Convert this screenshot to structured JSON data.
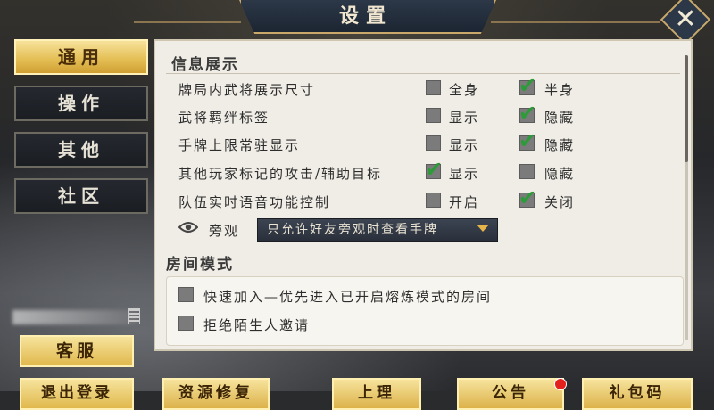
{
  "window": {
    "title": "设置",
    "close_icon": "close-icon"
  },
  "sidebar": {
    "tabs": [
      {
        "label": "通用",
        "active": true
      },
      {
        "label": "操作",
        "active": false
      },
      {
        "label": "其他",
        "active": false
      },
      {
        "label": "社区",
        "active": false
      }
    ],
    "customer_service": "客服",
    "logout": "退出登录"
  },
  "info_section": {
    "title": "信息展示",
    "rows": [
      {
        "label": "牌局内武将展示尺寸",
        "opt1": "全身",
        "opt1_checked": false,
        "opt2": "半身",
        "opt2_checked": true
      },
      {
        "label": "武将羁绊标签",
        "opt1": "显示",
        "opt1_checked": false,
        "opt2": "隐藏",
        "opt2_checked": true
      },
      {
        "label": "手牌上限常驻显示",
        "opt1": "显示",
        "opt1_checked": false,
        "opt2": "隐藏",
        "opt2_checked": true
      },
      {
        "label": "其他玩家标记的攻击/辅助目标",
        "opt1": "显示",
        "opt1_checked": true,
        "opt2": "隐藏",
        "opt2_checked": false
      },
      {
        "label": "队伍实时语音功能控制",
        "opt1": "开启",
        "opt1_checked": false,
        "opt2": "关闭",
        "opt2_checked": true
      }
    ],
    "spectate_label": "旁观",
    "spectate_value": "只允许好友旁观时查看手牌"
  },
  "room_section": {
    "title": "房间模式",
    "options": [
      {
        "label": "快速加入—优先进入已开启熔炼模式的房间",
        "checked": false
      },
      {
        "label": "拒绝陌生人邀请",
        "checked": false
      }
    ]
  },
  "bottom_bar": {
    "buttons": [
      "资源修复",
      "上理",
      "公告",
      "礼包码"
    ]
  },
  "colors": {
    "accent": "#e3bd52",
    "check": "#2e9b3a",
    "panel": "#f0ede6"
  }
}
